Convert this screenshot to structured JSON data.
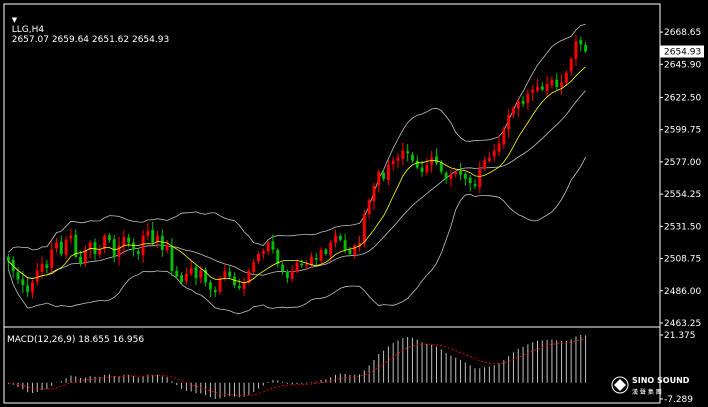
{
  "header": {
    "symbol": "LLG,H4",
    "ohlc": "2657.07 2659.64 2651.62 2654.93"
  },
  "macd": {
    "label": "MACD(12,26,9) 18.655 16.956",
    "axis_labels": [
      "21.375",
      "-7.289"
    ]
  },
  "watermark": {
    "brand": "SINO SOUND",
    "sub": "漢 聲 集 團"
  },
  "colors": {
    "bull": "#00c000",
    "bear": "#ff0000",
    "ma": "#ffff00",
    "bands": "#c0c0c0",
    "hist": "#c0c0c0",
    "signal": "#ff0000",
    "grid": "#ffffff"
  },
  "chart_data": [
    {
      "type": "candlestick",
      "symbol": "LLG",
      "timeframe": "H4",
      "ylim": [
        2463.25,
        2680
      ],
      "yticks": [
        "2668.65",
        "2645.90",
        "2622.50",
        "2599.75",
        "2577.00",
        "2554.25",
        "2531.50",
        "2508.75",
        "2486.00",
        "2463.25"
      ],
      "current_price": "2654.93",
      "close": [
        2507,
        2500,
        2494,
        2490,
        2485,
        2492,
        2500,
        2505,
        2502,
        2515,
        2520,
        2512,
        2522,
        2525,
        2510,
        2505,
        2515,
        2520,
        2512,
        2515,
        2525,
        2522,
        2510,
        2518,
        2524,
        2520,
        2515,
        2512,
        2525,
        2528,
        2520,
        2525,
        2515,
        2518,
        2500,
        2496,
        2492,
        2498,
        2502,
        2495,
        2500,
        2492,
        2487,
        2485,
        2495,
        2500,
        2496,
        2490,
        2488,
        2492,
        2500,
        2506,
        2512,
        2514,
        2520,
        2515,
        2505,
        2500,
        2495,
        2500,
        2506,
        2504,
        2505,
        2510,
        2508,
        2515,
        2512,
        2520,
        2525,
        2522,
        2515,
        2512,
        2518,
        2520,
        2540,
        2550,
        2560,
        2570,
        2565,
        2575,
        2578,
        2580,
        2585,
        2583,
        2578,
        2573,
        2570,
        2575,
        2580,
        2576,
        2570,
        2565,
        2568,
        2570,
        2568,
        2565,
        2562,
        2560,
        2572,
        2578,
        2580,
        2585,
        2590,
        2600,
        2610,
        2615,
        2620,
        2618,
        2625,
        2628,
        2630,
        2628,
        2632,
        2635,
        2630,
        2633,
        2640,
        2650,
        2662,
        2660,
        2655
      ],
      "bollinger_period": 20,
      "ma_period": 9
    },
    {
      "type": "bar",
      "name": "MACD(12,26,9)",
      "macd_value": 18.655,
      "signal_value": 16.956,
      "ylim": [
        -7.289,
        21.375
      ],
      "yticks": [
        "21.375",
        "-7.289"
      ]
    }
  ]
}
